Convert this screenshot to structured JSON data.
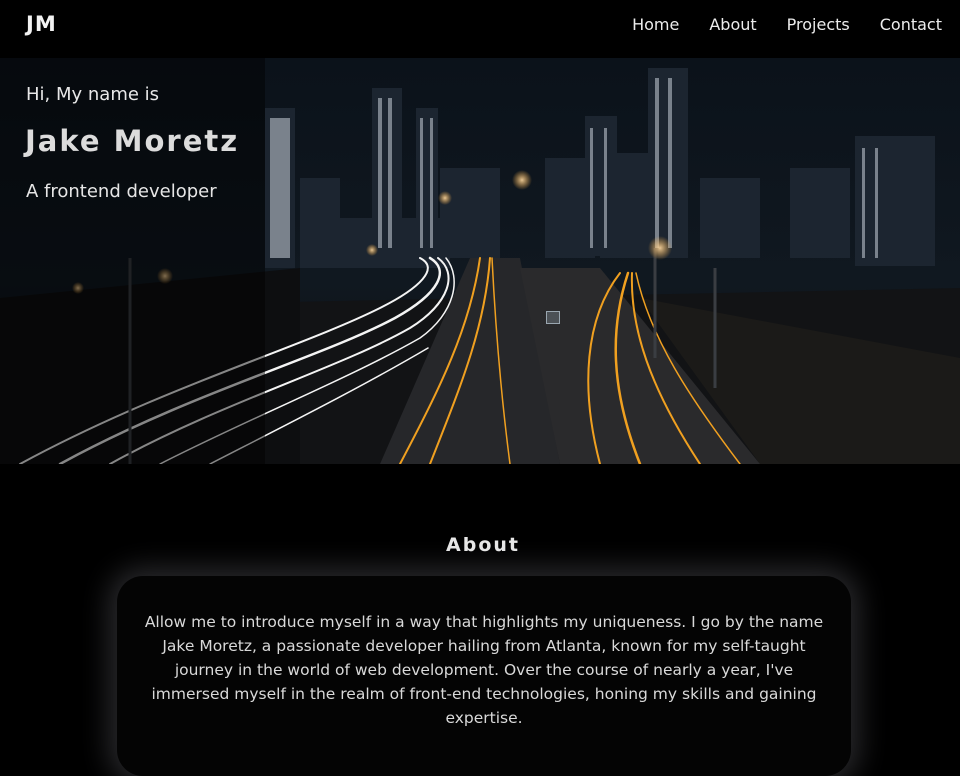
{
  "nav": {
    "logo": "JM",
    "links": [
      "Home",
      "About",
      "Projects",
      "Contact"
    ]
  },
  "hero": {
    "greeting": "Hi, My name is",
    "name": "Jake Moretz",
    "role": "A frontend developer",
    "background_image": "night city highway with light trails"
  },
  "about": {
    "title": "About",
    "text": "Allow me to introduce myself in a way that highlights my uniqueness. I go by the name Jake Moretz, a passionate developer hailing from Atlanta, known for my self-taught journey in the world of web development. Over the course of nearly a year, I've immersed myself in the realm of front-end technologies, honing my skills and gaining expertise."
  },
  "colors": {
    "background": "#000000",
    "text": "#ffffff",
    "light_trail_orange": "#f0a020",
    "light_trail_white": "#f4f4f4"
  }
}
